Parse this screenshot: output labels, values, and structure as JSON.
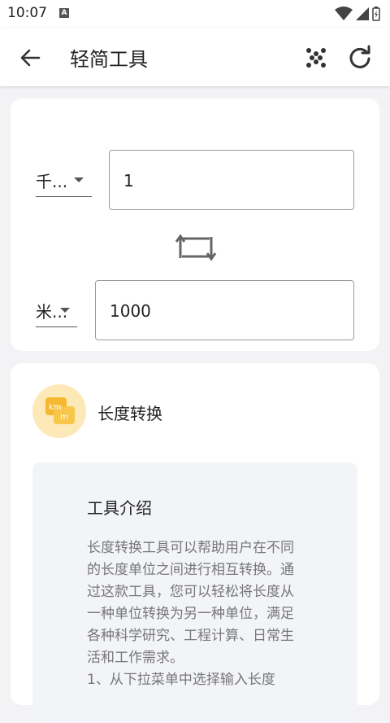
{
  "status": {
    "time": "10:07",
    "notification_badge": "A"
  },
  "appbar": {
    "title": "轻简工具"
  },
  "converter": {
    "from_unit": "千...",
    "from_value": "1",
    "to_unit": "米...",
    "to_value": "1000"
  },
  "tool": {
    "name": "长度转换",
    "icon_text_top": "km",
    "icon_text_bottom": "m"
  },
  "intro": {
    "title": "工具介绍",
    "body": "长度转换工具可以帮助用户在不同的长度单位之间进行相互转换。通过这款工具，您可以轻松将长度从一种单位转换为另一种单位，满足各种科学研究、工程计算、日常生活和工作需求。\n1、从下拉菜单中选择输入长度"
  },
  "colors": {
    "accent_icon": "#f5b82e",
    "icon_bg": "#fde9b8"
  }
}
